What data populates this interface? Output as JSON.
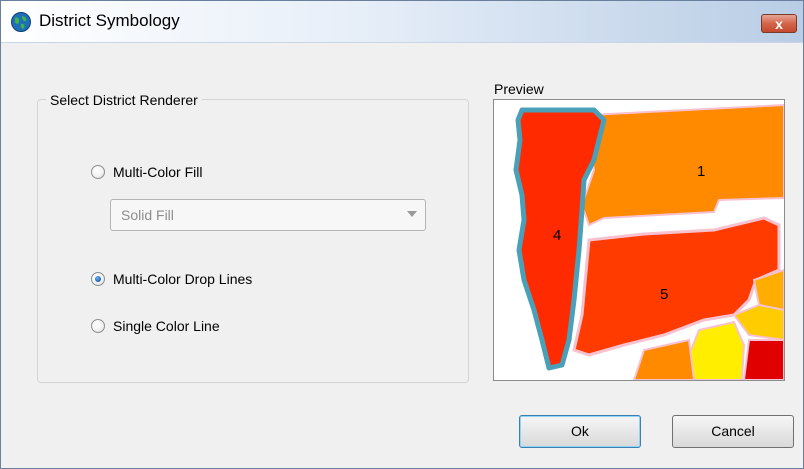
{
  "window": {
    "title": "District Symbology",
    "close_label": "x"
  },
  "renderer_group": {
    "legend": "Select District Renderer",
    "options": [
      {
        "label": "Multi-Color Fill",
        "checked": false
      },
      {
        "label": "Multi-Color Drop Lines",
        "checked": true
      },
      {
        "label": "Single Color Line",
        "checked": false
      }
    ],
    "fill_style_select": {
      "value": "Solid Fill",
      "enabled": false
    }
  },
  "preview": {
    "label": "Preview",
    "districts": [
      "1",
      "4",
      "5"
    ]
  },
  "buttons": {
    "ok_label": "Ok",
    "cancel_label": "Cancel"
  }
}
